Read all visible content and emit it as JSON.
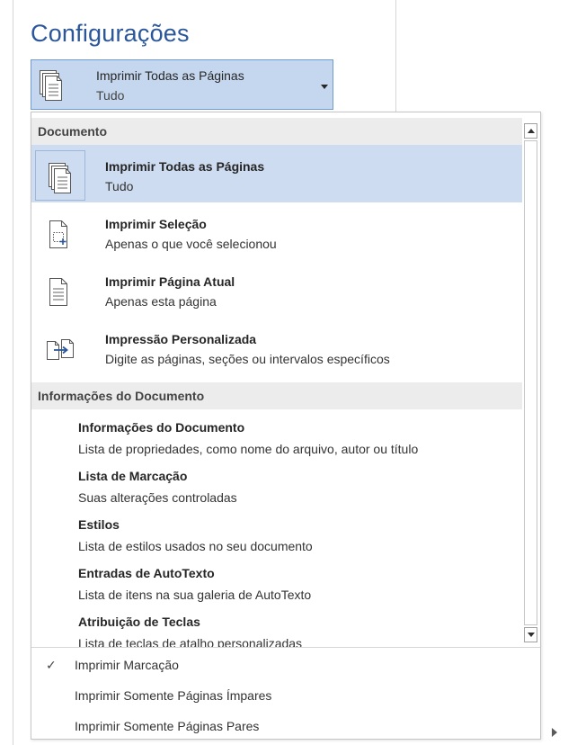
{
  "title": "Configurações",
  "dropdown": {
    "label": "Imprimir Todas as Páginas",
    "sublabel": "Tudo",
    "icon": "print-all-pages-icon"
  },
  "menu": {
    "section1": "Documento",
    "items": [
      {
        "title": "Imprimir Todas as Páginas",
        "desc": "Tudo",
        "icon": "print-all-pages-icon",
        "selected": true
      },
      {
        "title": "Imprimir Seleção",
        "desc": "Apenas o que você selecionou",
        "icon": "print-selection-icon",
        "selected": false
      },
      {
        "title": "Imprimir Página Atual",
        "desc": "Apenas esta página",
        "icon": "print-current-page-icon",
        "selected": false
      },
      {
        "title": "Impressão Personalizada",
        "desc": "Digite as páginas, seções ou intervalos específicos",
        "icon": "custom-print-icon",
        "selected": false
      }
    ],
    "section2": "Informações do Documento",
    "info_items": [
      {
        "title": "Informações do Documento",
        "desc": "Lista de propriedades, como nome do arquivo, autor ou título"
      },
      {
        "title": "Lista de Marcação",
        "desc": "Suas alterações controladas"
      },
      {
        "title": "Estilos",
        "desc": "Lista de estilos usados no seu documento"
      },
      {
        "title": "Entradas de AutoTexto",
        "desc": "Lista de itens na sua galeria de AutoTexto"
      },
      {
        "title": "Atribuição de Teclas",
        "desc": "Lista de teclas de atalho personalizadas"
      }
    ],
    "options": [
      {
        "label": "Imprimir Marcação",
        "checked": true,
        "check_glyph": "✓"
      },
      {
        "label": "Imprimir Somente Páginas Ímpares",
        "checked": false
      },
      {
        "label": "Imprimir Somente Páginas Pares",
        "checked": false
      }
    ]
  },
  "colors": {
    "title": "#2b579a",
    "dropdown_bg": "#c5d7ee",
    "dropdown_border": "#6f9ccc",
    "selected_bg": "#cddcf0",
    "section_header_bg": "#ececec"
  }
}
